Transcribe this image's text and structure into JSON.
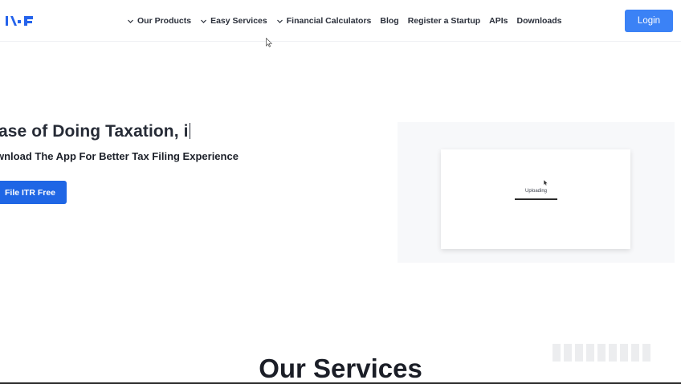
{
  "header": {
    "nav": [
      {
        "label": "Our Products",
        "has_dropdown": true
      },
      {
        "label": "Easy Services",
        "has_dropdown": true
      },
      {
        "label": "Financial Calculators",
        "has_dropdown": true
      },
      {
        "label": "Blog",
        "has_dropdown": false
      },
      {
        "label": "Register a Startup",
        "has_dropdown": false
      },
      {
        "label": "APIs",
        "has_dropdown": false
      },
      {
        "label": "Downloads",
        "has_dropdown": false
      }
    ],
    "login_label": "Login"
  },
  "hero": {
    "title": "ase of Doing Taxation, i",
    "subtitle": "wnload The App For Better Tax Filing Experience",
    "cta_label": "File ITR Free"
  },
  "preview": {
    "status_text": "Uploading"
  },
  "services": {
    "heading": "Our Services"
  },
  "icons": {
    "logo": "brand-logo",
    "chevron": "chevron-down-icon",
    "cursor": "mouse-pointer-icon"
  },
  "colors": {
    "accent": "#3b82f6",
    "cta": "#1f66e5",
    "logo": "#2563eb",
    "text": "#1b1f2a"
  }
}
